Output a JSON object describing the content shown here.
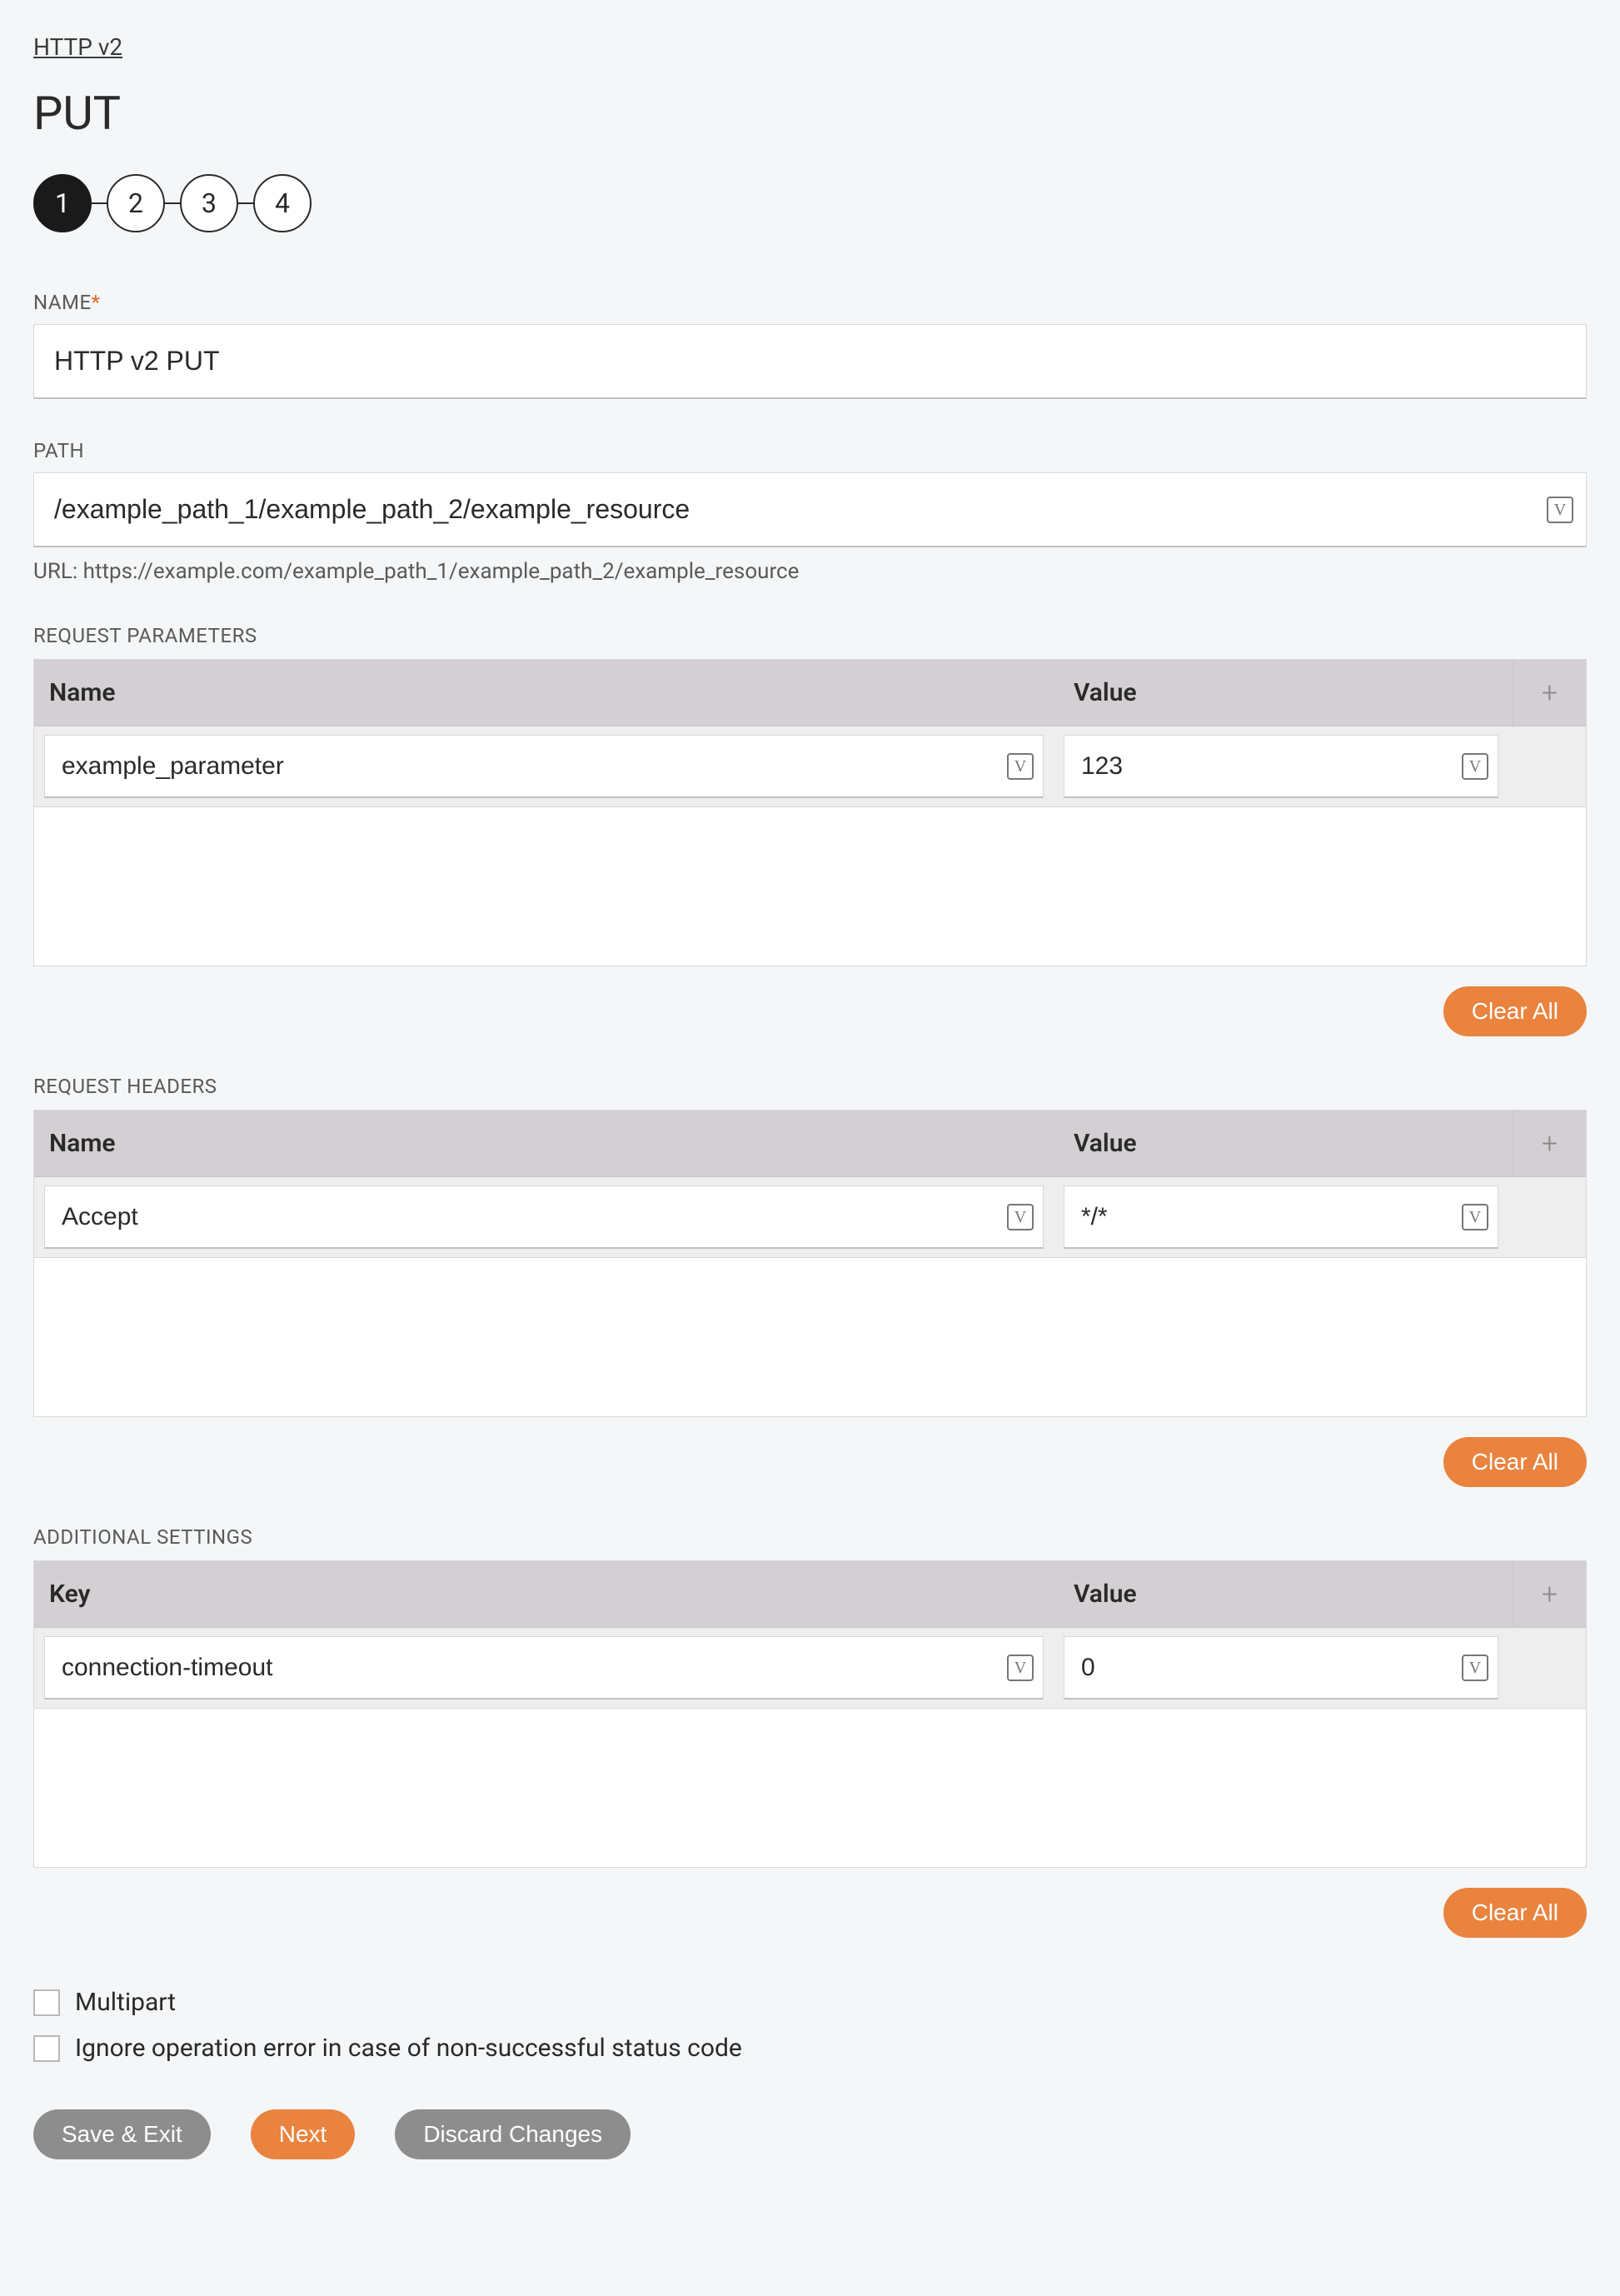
{
  "breadcrumb": {
    "label": "HTTP v2"
  },
  "title": "PUT",
  "stepper": {
    "steps": [
      "1",
      "2",
      "3",
      "4"
    ],
    "active": 0
  },
  "name_field": {
    "label": "NAME",
    "required": "*",
    "value": "HTTP v2 PUT"
  },
  "path_field": {
    "label": "PATH",
    "value": "/example_path_1/example_path_2/example_resource",
    "help_prefix": "URL: ",
    "help_url": "https://example.com/example_path_1/example_path_2/example_resource"
  },
  "request_params": {
    "label": "REQUEST PARAMETERS",
    "col_name": "Name",
    "col_value": "Value",
    "row": {
      "name": "example_parameter",
      "value": "123"
    },
    "clear_label": "Clear All"
  },
  "request_headers": {
    "label": "REQUEST HEADERS",
    "col_name": "Name",
    "col_value": "Value",
    "row": {
      "name": "Accept",
      "value": "*/*"
    },
    "clear_label": "Clear All"
  },
  "additional_settings": {
    "label": "ADDITIONAL SETTINGS",
    "col_name": "Key",
    "col_value": "Value",
    "row": {
      "name": "connection-timeout",
      "value": "0"
    },
    "clear_label": "Clear All"
  },
  "checkboxes": {
    "multipart": "Multipart",
    "ignore_error": "Ignore operation error in case of non-successful status code"
  },
  "footer": {
    "save_exit": "Save & Exit",
    "next": "Next",
    "discard": "Discard Changes"
  }
}
